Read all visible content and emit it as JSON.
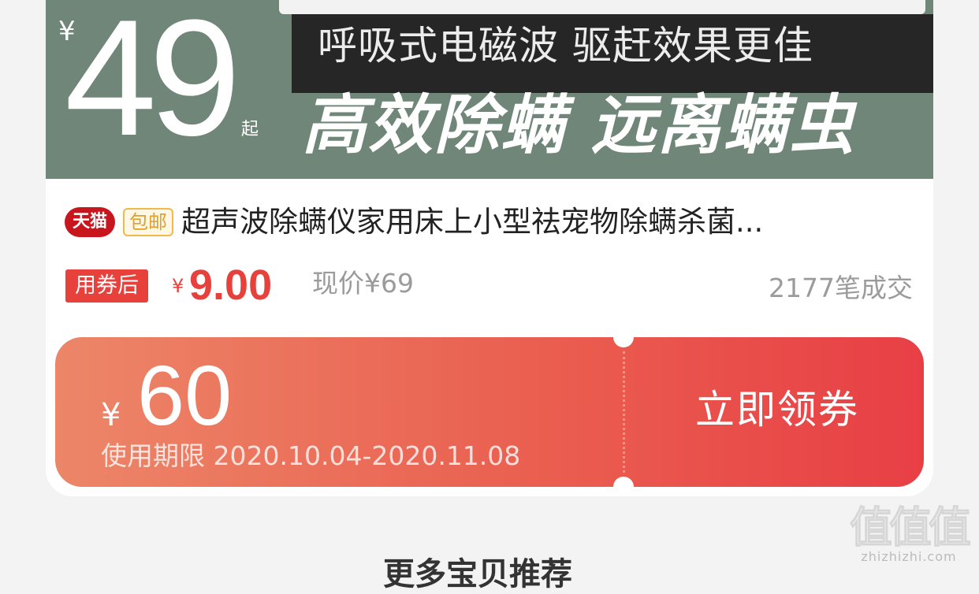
{
  "banner": {
    "yen_symbol": "¥",
    "price": "49",
    "price_suffix": "起",
    "tagline": "呼吸式电磁波 驱赶效果更佳",
    "headline": "高效除螨 远离螨虫",
    "background_color": "#6f8678"
  },
  "product": {
    "badge_tmall": "天猫",
    "badge_free_shipping": "包邮",
    "title": "超声波除螨仪家用床上小型祛宠物除螨杀菌...",
    "coupon_price_label": "用券后",
    "coupon_price_yen": "¥",
    "coupon_price": "9.00",
    "current_price": "现价¥69",
    "sales": "2177笔成交",
    "accent_color": "#e8413c"
  },
  "coupon": {
    "yen_symbol": "¥",
    "amount": "60",
    "validity": "使用期限 2020.10.04-2020.11.08",
    "cta": "立即领券"
  },
  "section": {
    "more_recommendations": "更多宝贝推荐"
  },
  "watermark": {
    "glyphs": "值值值",
    "url": "zhizhizhi.com"
  }
}
